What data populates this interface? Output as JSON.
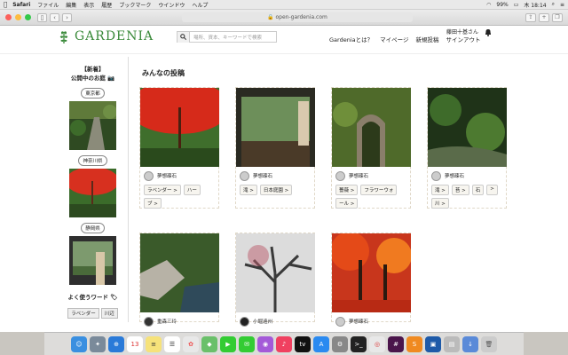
{
  "menubar": {
    "apple": "",
    "app": "Safari",
    "items": [
      "ファイル",
      "編集",
      "表示",
      "履歴",
      "ブックマーク",
      "ウインドウ",
      "ヘルプ"
    ],
    "battery": "99%",
    "clock": "木 18:14"
  },
  "browser": {
    "url": "open-gardenia.com"
  },
  "site": {
    "logo": "GARDENIA",
    "search_placeholder": "場所、資本、キーワードで検索",
    "nav": [
      "Gardeniaとは？",
      "マイページ",
      "新規投稿",
      "サインアウト"
    ],
    "user": "藤田十基さん"
  },
  "sidebar": {
    "heading1": "【新着】",
    "heading2": "公開中のお庭 📷",
    "regions": [
      "東京都",
      "神奈川県",
      "静岡県"
    ],
    "fav_title": "よく使うワード 🏷",
    "fav_tags": [
      "ラベンダー",
      "川辺"
    ]
  },
  "main": {
    "title": "みんなの投稿",
    "cards": [
      {
        "user": "夢想疎石",
        "tags": [
          "ラベンダー >",
          "ハー",
          "ブ >"
        ]
      },
      {
        "user": "夢想疎石",
        "tags": [
          "滝 >",
          "日本庭園 >"
        ]
      },
      {
        "user": "夢想疎石",
        "tags": [
          "薔薇 >",
          "フラワーウォ",
          "ール >"
        ]
      },
      {
        "user": "夢想疎石",
        "tags": [
          "滝 >",
          "苔 >",
          "石",
          "> ",
          "川 >"
        ]
      },
      {
        "user": "重森三玲",
        "tags": []
      },
      {
        "user": "小堀遠州",
        "tags": []
      },
      {
        "user": "夢想疎石",
        "tags": []
      }
    ]
  },
  "dock": {
    "calendar_day": "13"
  }
}
